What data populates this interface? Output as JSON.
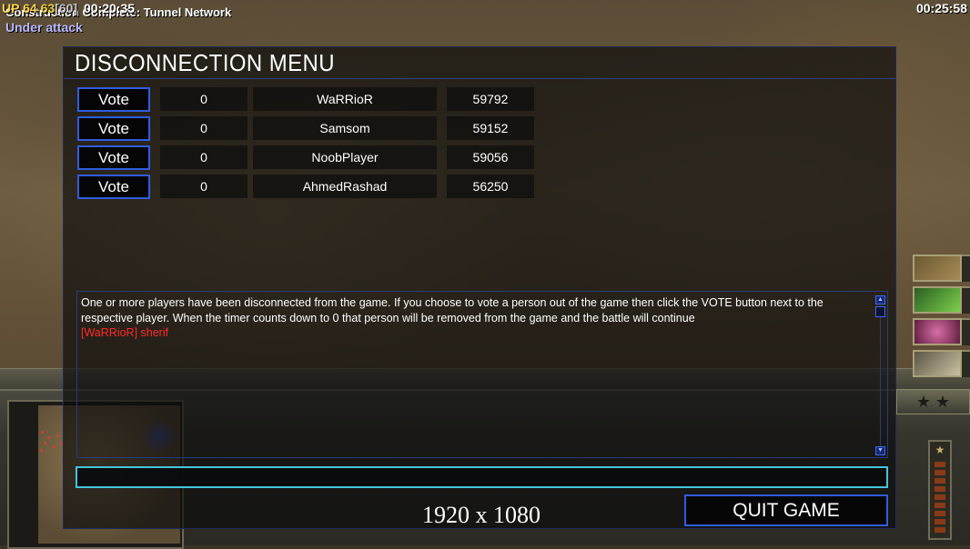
{
  "hud": {
    "fps_prefix": "UP",
    "fps_a": "64",
    "fps_b": "63",
    "fps_c": "[60]",
    "game_time": "00:20:35",
    "real_time": "00:25:58",
    "message": "Construction Complete: Tunnel Network",
    "status": "Under attack"
  },
  "dialog": {
    "title": "DISCONNECTION MENU",
    "vote_label": "Vote",
    "players": [
      {
        "votes": "0",
        "name": "WaRRioR",
        "ping": "59792"
      },
      {
        "votes": "0",
        "name": "Samsom",
        "ping": "59152"
      },
      {
        "votes": "0",
        "name": "NoobPlayer",
        "ping": "59056"
      },
      {
        "votes": "0",
        "name": "AhmedRashad",
        "ping": "56250"
      }
    ],
    "info_text": "One or more players have been disconnected from the game. If you choose to vote a person out of the game then click the VOTE button next to the respective player. When the timer counts down to 0 that person will be removed from the game and the battle will continue",
    "chat_line": "[WaRRioR] sherif",
    "chat_input_value": "",
    "quit_label": "QUIT GAME"
  },
  "overlay": {
    "resolution": "1920 x 1080"
  },
  "colors": {
    "accent_blue": "#2f5de0",
    "input_cyan": "#46c4dc",
    "chat_red": "#ff2a2a",
    "status_violet": "#b9b9ff"
  }
}
